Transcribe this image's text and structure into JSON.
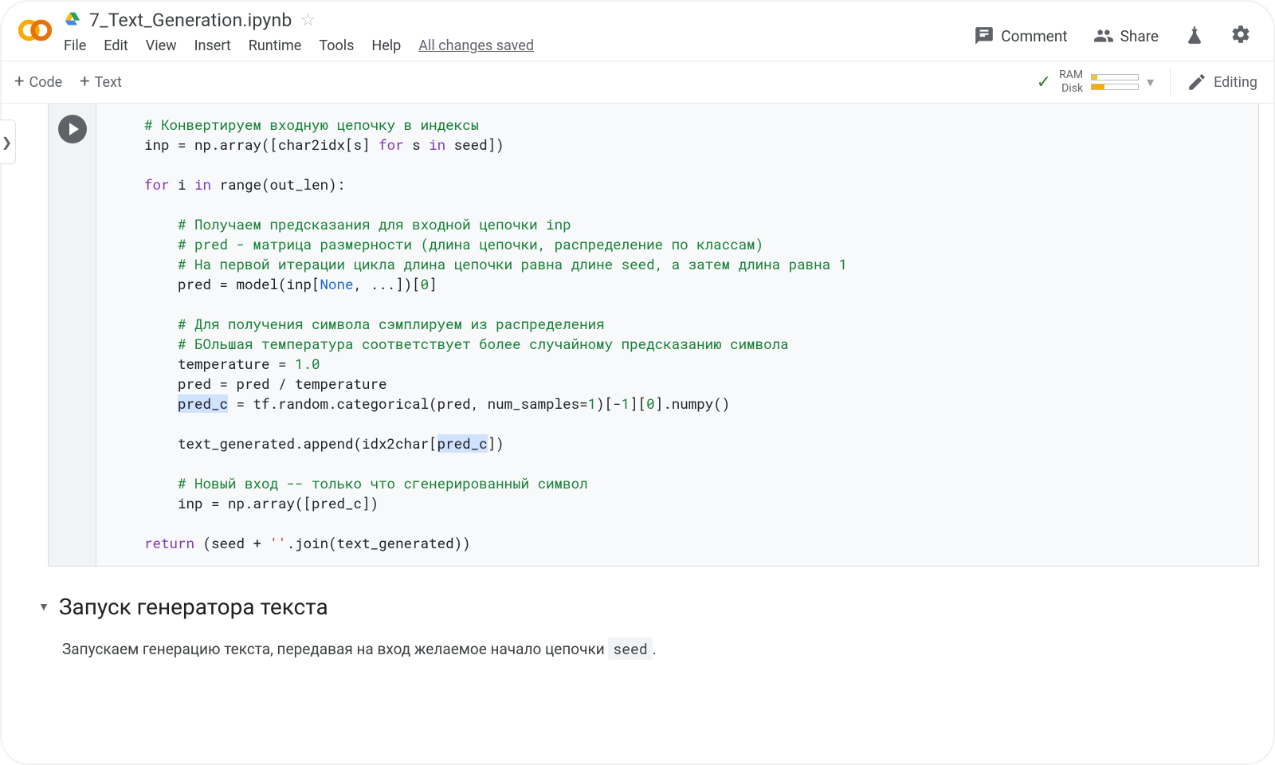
{
  "header": {
    "doc_title": "7_Text_Generation.ipynb",
    "menu": {
      "file": "File",
      "edit": "Edit",
      "view": "View",
      "insert": "Insert",
      "runtime": "Runtime",
      "tools": "Tools",
      "help": "Help",
      "saved": "All changes saved"
    },
    "actions": {
      "comment": "Comment",
      "share": "Share"
    }
  },
  "toolbar": {
    "code": "Code",
    "text": "Text",
    "ram": "RAM",
    "disk": "Disk",
    "editing": "Editing"
  },
  "code": {
    "c1": "# Конвертируем входную цепочку в индексы",
    "l2a": "inp = np.array([char2idx[s] ",
    "l2for": "for",
    "l2b": " s ",
    "l2in": "in",
    "l2c": " seed])",
    "l3for": "for",
    "l3a": " i ",
    "l3in": "in",
    "l3b": " range(out_len):",
    "c4": "# Получаем предсказания для входной цепочки inp",
    "c5": "# pred - матрица размерности (длина цепочки, распределение по классам)",
    "c6": "# На первой итерации цикла длина цепочки равна длине seed, а затем длина равна 1",
    "l7a": "pred = model(inp[",
    "l7none": "None",
    "l7b": ", ...])[",
    "l7idx": "0",
    "l7c": "]",
    "c8": "# Для получения символа сэмплируем из распределения",
    "c9": "# БОльшая температура соответствует более случайному предсказанию символа",
    "l10a": "temperature = ",
    "l10n": "1.0",
    "l11": "pred = pred / temperature",
    "l12sel": "pred_c",
    "l12a": " = tf.random.categorical(pred, num_samples=",
    "l12n1": "1",
    "l12b": ")[-",
    "l12n2": "1",
    "l12c": "][",
    "l12n3": "0",
    "l12d": "].numpy()",
    "l13a": "text_generated.append(idx2char[",
    "l13sel": "pred_c",
    "l13b": "])",
    "c14": "# Новый вход -- только что сгенерированный символ",
    "l15": "inp = np.array([pred_c])",
    "l16ret": "return",
    "l16a": " (seed + ",
    "l16str": "''",
    "l16b": ".join(text_generated))"
  },
  "section": {
    "title": "Запуск генератора текста",
    "text_prefix": "Запускаем генерацию текста, передавая на вход желаемое начало цепочки ",
    "seed": "seed",
    "period": "."
  }
}
